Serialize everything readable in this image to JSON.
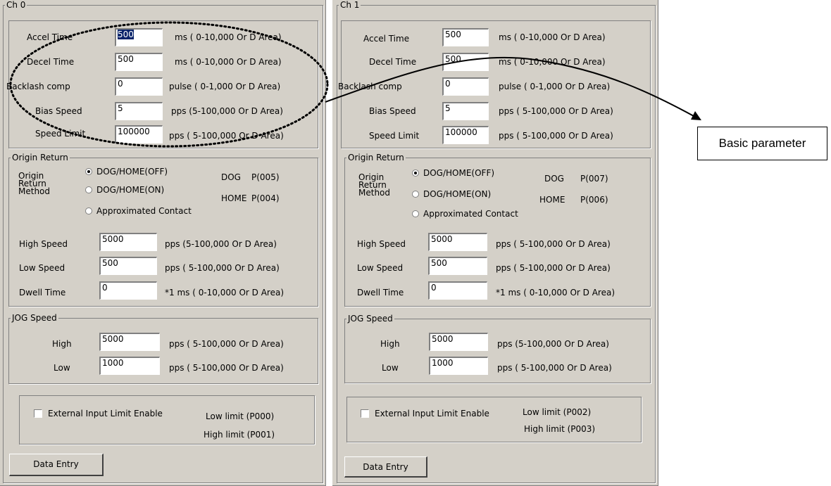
{
  "channels": [
    {
      "title": "Ch 0",
      "basic": [
        {
          "label": "Accel Time",
          "value": "500",
          "selected": true,
          "range": "ms ( 0-10,000 Or D Area)"
        },
        {
          "label": "Decel Time",
          "value": "500",
          "range": "ms ( 0-10,000 Or D Area)"
        },
        {
          "label": "Backlash comp",
          "value": "0",
          "range": "pulse ( 0-1,000 Or D Area)"
        },
        {
          "label": "Bias Speed",
          "value": "5",
          "range": "pps (5-100,000 Or D Area)"
        },
        {
          "label": "Speed Limit",
          "value": "100000",
          "range": "pps ( 5-100,000 Or D Area)"
        }
      ],
      "origin": {
        "title": "Origin Return",
        "method_label": "Origin Return Method",
        "method_lines": [
          "Origin",
          "Return",
          "Method"
        ],
        "options": [
          "DOG/HOME(OFF)",
          "DOG/HOME(ON)",
          "Approximated Contact"
        ],
        "selected_index": 0,
        "dog_label": "DOG",
        "dog_value": "P(005)",
        "home_label": "HOME",
        "home_value": "P(004)",
        "rows": [
          {
            "label": "High Speed",
            "value": "5000",
            "range": "pps (5-100,000 Or D Area)"
          },
          {
            "label": "Low Speed",
            "value": "500",
            "range": "pps ( 5-100,000 Or D Area)"
          },
          {
            "label": "Dwell Time",
            "value": "0",
            "range": "*1 ms ( 0-10,000 Or D Area)"
          }
        ]
      },
      "jog": {
        "title": "JOG Speed",
        "rows": [
          {
            "label": "High",
            "value": "5000",
            "range": "pps ( 5-100,000 Or D Area)"
          },
          {
            "label": "Low",
            "value": "1000",
            "range": "pps ( 5-100,000 Or D Area)"
          }
        ]
      },
      "limit": {
        "checkbox_label": "External Input Limit Enable",
        "checked": false,
        "low": "Low limit (P000)",
        "high": "High limit (P001)"
      },
      "data_entry": "Data Entry"
    },
    {
      "title": "Ch 1",
      "basic": [
        {
          "label": "Accel Time",
          "value": "500",
          "range": "ms ( 0-10,000 Or D Area)"
        },
        {
          "label": "Decel Time",
          "value": "500",
          "range": "ms ( 0-10,000 Or D Area)"
        },
        {
          "label": "Backlash comp",
          "value": "0",
          "range": "pulse ( 0-1,000 Or D Area)"
        },
        {
          "label": "Bias Speed",
          "value": "5",
          "range": "pps ( 5-100,000 Or D Area)"
        },
        {
          "label": "Speed Limit",
          "value": "100000",
          "range": "pps ( 5-100,000 Or D Area)"
        }
      ],
      "origin": {
        "title": "Origin Return",
        "method_label": "Origin Return Method",
        "method_lines": [
          "Origin",
          "Return",
          "Method"
        ],
        "options": [
          "DOG/HOME(OFF)",
          "DOG/HOME(ON)",
          "Approximated Contact"
        ],
        "selected_index": 0,
        "dog_label": "DOG",
        "dog_value": "P(007)",
        "home_label": "HOME",
        "home_value": "P(006)",
        "rows": [
          {
            "label": "High Speed",
            "value": "5000",
            "range": "pps ( 5-100,000 Or D Area)"
          },
          {
            "label": "Low Speed",
            "value": "500",
            "range": "pps ( 5-100,000 Or D Area)"
          },
          {
            "label": "Dwell Time",
            "value": "0",
            "range": "*1 ms ( 0-10,000 Or D Area)"
          }
        ]
      },
      "jog": {
        "title": "JOG Speed",
        "rows": [
          {
            "label": "High",
            "value": "5000",
            "range": "pps (5-100,000 Or D Area)"
          },
          {
            "label": "Low",
            "value": "1000",
            "range": "pps ( 5-100,000 Or D Area)"
          }
        ]
      },
      "limit": {
        "checkbox_label": "External Input Limit Enable",
        "checked": false,
        "low": "Low limit (P002)",
        "high": "High limit (P003)"
      },
      "data_entry": "Data Entry"
    }
  ],
  "annotation": {
    "label": "Basic parameter",
    "highlight_target": "basic-parameter-group-ch0"
  },
  "colors": {
    "dialog_bg": "#d4d0c8",
    "selection": "#0a246a"
  }
}
